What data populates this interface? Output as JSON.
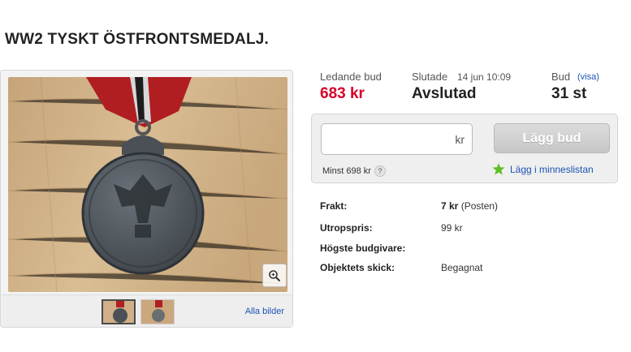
{
  "listing": {
    "title": "WW2 TYSKT ÖSTFRONTSMEDALJ."
  },
  "gallery": {
    "all_images_label": "Alla bilder"
  },
  "summary": {
    "leading_bid_label": "Ledande bud",
    "leading_bid_value": "683 kr",
    "ended_label": "Slutade",
    "ended_time": "14 jun 10:09",
    "ended_value": "Avslutad",
    "bids_label": "Bud",
    "bids_show_link": "(visa)",
    "bids_value": "31 st"
  },
  "bid_box": {
    "input_value": "",
    "currency": "kr",
    "button_label": "Lägg bud",
    "min_text": "Minst 698 kr",
    "help_glyph": "?",
    "wishlist_label": "Lägg i minneslistan"
  },
  "details": {
    "shipping_label": "Frakt:",
    "shipping_amount": "7 kr",
    "shipping_method": "(Posten)",
    "start_price_label": "Utropspris:",
    "start_price_value": "99 kr",
    "top_bidder_label": "Högste budgivare:",
    "condition_label": "Objektets skick:",
    "condition_value": "Begagnat"
  },
  "colors": {
    "price_red": "#d5002a",
    "link_blue": "#1b53b4",
    "star_green": "#5bbf21"
  },
  "icons": [
    "zoom-icon",
    "help-icon",
    "star-icon"
  ]
}
